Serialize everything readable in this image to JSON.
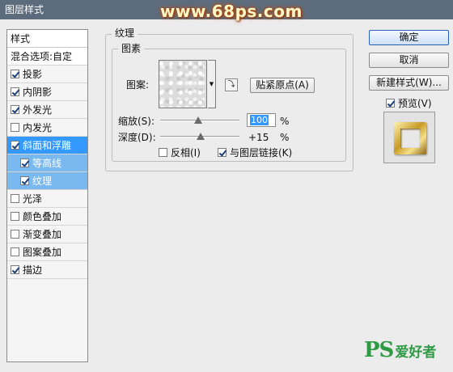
{
  "dialog": {
    "title": "图层样式",
    "watermark": "www.68ps.com"
  },
  "styles_panel": {
    "header": "样式",
    "blend_options": "混合选项:自定",
    "items": [
      {
        "label": "投影",
        "checked": true
      },
      {
        "label": "内阴影",
        "checked": true
      },
      {
        "label": "外发光",
        "checked": true
      },
      {
        "label": "内发光",
        "checked": false
      },
      {
        "label": "斜面和浮雕",
        "checked": true,
        "selected": true
      },
      {
        "label": "等高线",
        "checked": true,
        "sub": true
      },
      {
        "label": "纹理",
        "checked": true,
        "sub": true
      },
      {
        "label": "光泽",
        "checked": false
      },
      {
        "label": "颜色叠加",
        "checked": false
      },
      {
        "label": "渐变叠加",
        "checked": false
      },
      {
        "label": "图案叠加",
        "checked": false
      },
      {
        "label": "描边",
        "checked": true
      }
    ]
  },
  "texture": {
    "group_title": "纹理",
    "pattern_group_title": "图素",
    "pattern_label": "图案:",
    "snap_origin_button": "贴紧原点(A)",
    "scale_label": "缩放(S):",
    "scale_value": "100",
    "scale_level": 100,
    "depth_label": "深度(D):",
    "depth_value": "+15",
    "depth_level": 15,
    "percent": "%",
    "invert_label": "反相(I)",
    "invert_checked": false,
    "link_label": "与图层链接(K)",
    "link_checked": true
  },
  "buttons": {
    "ok": "确定",
    "cancel": "取消",
    "new_style": "新建样式(W)...",
    "preview_label": "预览(V)",
    "preview_checked": true
  },
  "logo": {
    "ps": "PS",
    "text": "爱好者"
  },
  "colors": {
    "selection": "#3399ff",
    "title_bar": "#5d6c7c",
    "logo_green": "#2e9a44"
  }
}
